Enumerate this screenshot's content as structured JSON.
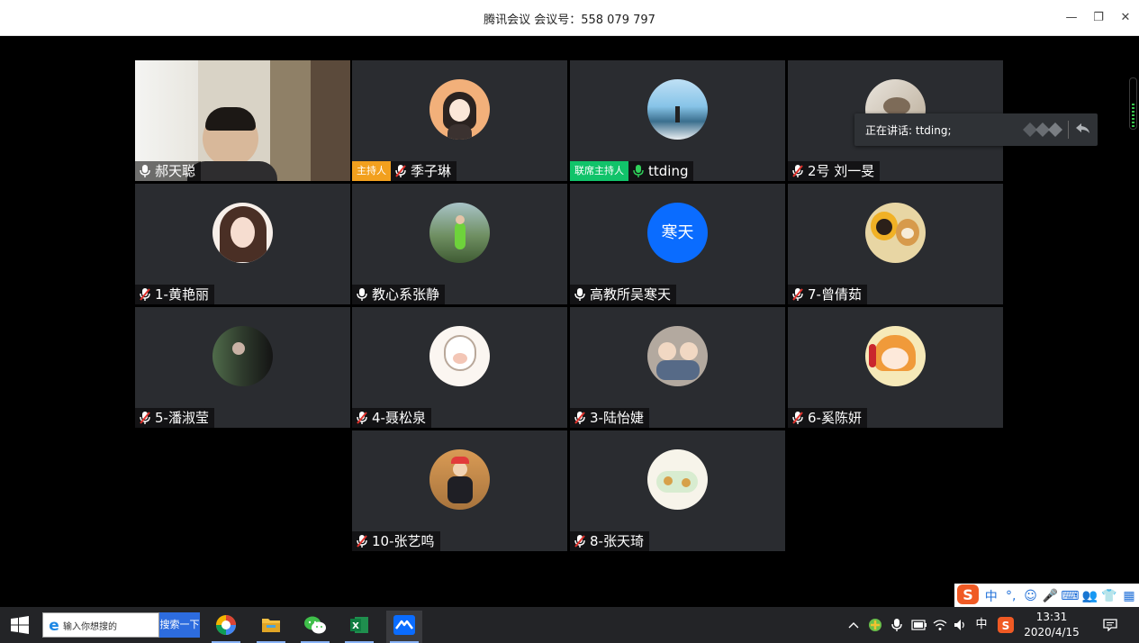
{
  "window": {
    "title": "腾讯会议 会议号：558 079 797",
    "minimize": "—",
    "restore": "❐",
    "close": "✕"
  },
  "participants": [
    {
      "name": "郝天聪",
      "badge": "",
      "muted": false,
      "video": true
    },
    {
      "name": "季子琳",
      "badge": "主持人",
      "badge_type": "host",
      "muted": true
    },
    {
      "name": "ttding",
      "badge": "联席主持人",
      "badge_type": "cohost",
      "muted": false,
      "speaking": true
    },
    {
      "name": "2号 刘一旻",
      "badge": "",
      "muted": true
    },
    {
      "name": "1-黄艳丽",
      "badge": "",
      "muted": true
    },
    {
      "name": "教心系张静",
      "badge": "",
      "muted": false
    },
    {
      "name": "高教所吴寒天",
      "badge": "",
      "muted": false,
      "avatar_text": "寒天",
      "avatar_color": "#0a6cff"
    },
    {
      "name": "7-曾倩茹",
      "badge": "",
      "muted": true
    },
    {
      "name": "5-潘淑莹",
      "badge": "",
      "muted": true
    },
    {
      "name": "4-聂松泉",
      "badge": "",
      "muted": true
    },
    {
      "name": "3-陆怡婕",
      "badge": "",
      "muted": true
    },
    {
      "name": "6-奚陈妍",
      "badge": "",
      "muted": true
    },
    {
      "name": "10-张艺鸣",
      "badge": "",
      "muted": true
    },
    {
      "name": "8-张天琦",
      "badge": "",
      "muted": true
    }
  ],
  "speaking_banner": {
    "text": "正在讲话: ttding;"
  },
  "ime": {
    "mode": "中",
    "punct": "°,"
  },
  "taskbar": {
    "search_placeholder": "输入你想搜的",
    "search_button": "搜索一下",
    "ime_lang": "中",
    "time": "13:31",
    "date": "2020/4/15"
  },
  "colors": {
    "host_badge": "#f2a01e",
    "cohost_badge": "#11c36a",
    "tile_bg": "#2a2c30",
    "speaking_mic": "#2fd15a"
  }
}
